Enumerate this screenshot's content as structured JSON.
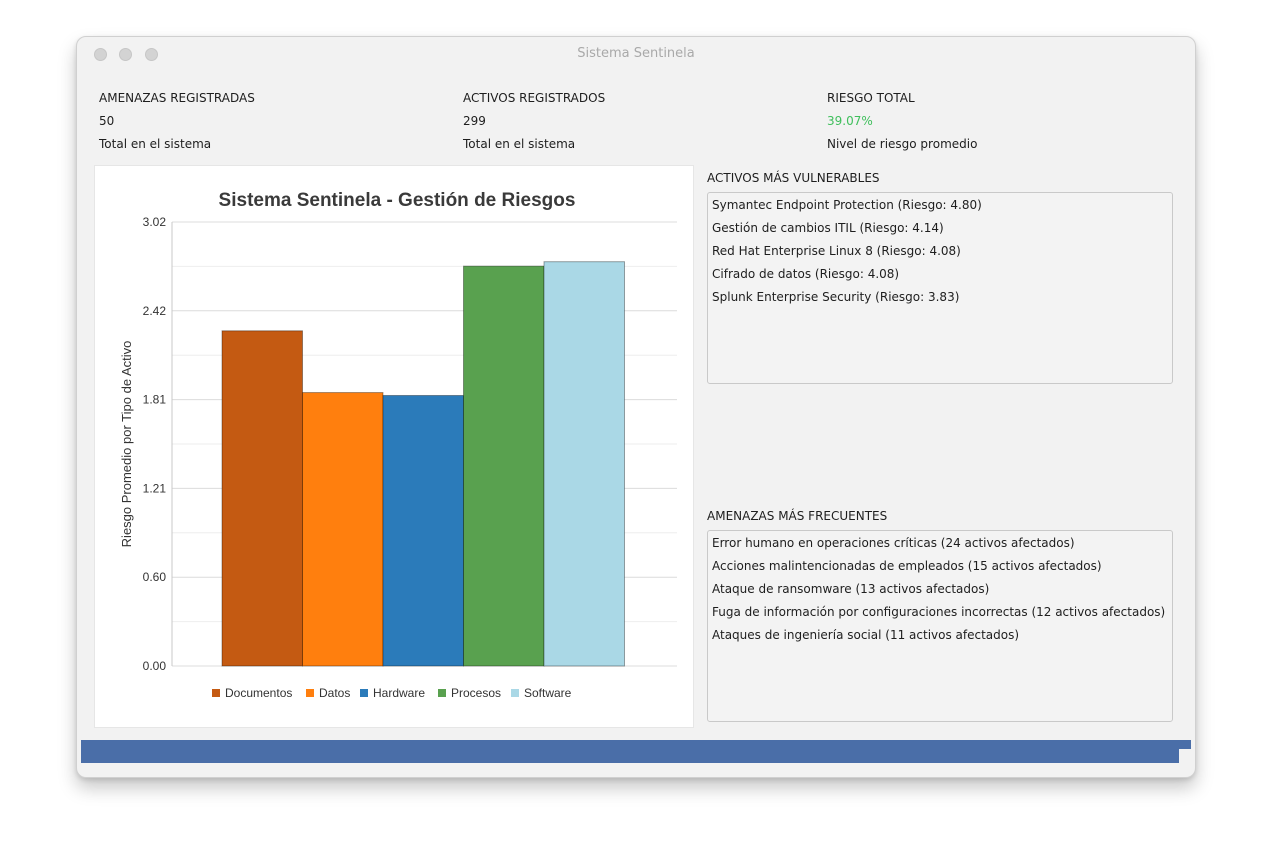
{
  "window": {
    "title": "Sistema Sentinela"
  },
  "stats": [
    {
      "label": "AMENAZAS REGISTRADAS",
      "value": "50",
      "caption": "Total en el sistema"
    },
    {
      "label": "ACTIVOS REGISTRADOS",
      "value": "299",
      "caption": "Total en el sistema"
    },
    {
      "label": "RIESGO TOTAL",
      "value": "39.07%",
      "caption": "Nivel de riesgo promedio",
      "value_color": "#3fbf5c"
    }
  ],
  "vulnerable_assets": {
    "title": "ACTIVOS MÁS VULNERABLES",
    "items": [
      "Symantec Endpoint Protection (Riesgo: 4.80)",
      "Gestión de cambios ITIL (Riesgo: 4.14)",
      "Red Hat Enterprise Linux 8 (Riesgo: 4.08)",
      "Cifrado de datos (Riesgo: 4.08)",
      "Splunk Enterprise Security (Riesgo: 3.83)"
    ]
  },
  "frequent_threats": {
    "title": "AMENAZAS MÁS FRECUENTES",
    "items": [
      "Error humano en operaciones críticas (24 activos afectados)",
      "Acciones malintencionadas de empleados (15 activos afectados)",
      "Ataque de ransomware (13 activos afectados)",
      "Fuga de información por configuraciones incorrectas (12 activos afectados)",
      "Ataques de ingeniería social (11 activos afectados)"
    ]
  },
  "chart_data": {
    "type": "bar",
    "title": "Sistema Sentinela - Gestión de Riesgos",
    "xlabel": "",
    "ylabel": "Riesgo Promedio por Tipo de Activo",
    "ylim": [
      0,
      3.02
    ],
    "yticks": [
      "0.00",
      "0.60",
      "1.21",
      "1.81",
      "2.42",
      "3.02"
    ],
    "grid": true,
    "legend_position": "bottom",
    "series": [
      {
        "name": "Documentos",
        "value": 2.28,
        "color": "#c45a12"
      },
      {
        "name": "Datos",
        "value": 1.86,
        "color": "#ff7f0e"
      },
      {
        "name": "Hardware",
        "value": 1.84,
        "color": "#2b7bba"
      },
      {
        "name": "Procesos",
        "value": 2.72,
        "color": "#59a14f"
      },
      {
        "name": "Software",
        "value": 2.75,
        "color": "#aad8e6"
      }
    ]
  },
  "bottom_bar": {
    "color": "#4a6ea8"
  }
}
